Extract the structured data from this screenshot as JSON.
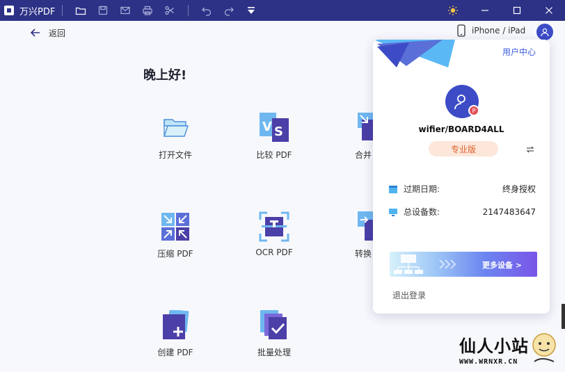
{
  "app": {
    "name": "万兴PDF",
    "titlebar_icons": [
      "folder-icon",
      "save-icon",
      "mail-icon",
      "print-icon",
      "scissors-icon",
      "undo-icon",
      "redo-icon",
      "dropdown-icon"
    ],
    "theme_icon": "sun-icon",
    "window_controls": [
      "minimize-icon",
      "maximize-icon",
      "close-icon"
    ]
  },
  "nav": {
    "back_label": "返回"
  },
  "greeting": "晚上好!",
  "tools": [
    {
      "label": "打开文件",
      "icon": "folder-open-icon"
    },
    {
      "label": "比较 PDF",
      "icon": "compare-icon"
    },
    {
      "label": "合并",
      "icon": "merge-icon"
    },
    {
      "label": "压缩 PDF",
      "icon": "compress-icon"
    },
    {
      "label": "OCR PDF",
      "icon": "ocr-icon"
    },
    {
      "label": "转换",
      "icon": "convert-icon"
    },
    {
      "label": "创建 PDF",
      "icon": "create-icon"
    },
    {
      "label": "批量处理",
      "icon": "batch-icon"
    }
  ],
  "device": {
    "label": "iPhone / iPad"
  },
  "panel": {
    "user_center": "用户中心",
    "username": "wifier/BOARD4ALL",
    "badge_letter": "P",
    "plan": "专业版",
    "expiry_label": "过期日期:",
    "expiry_value": "终身授权",
    "devices_label": "总设备数:",
    "devices_value": "2147483647",
    "more_devices": "更多设备 >",
    "logout": "退出登录"
  },
  "watermark": {
    "title": "仙人小站",
    "url": "WWW.WRNXR.CN"
  },
  "colors": {
    "titlebar": "#2d3286",
    "accent": "#3d4cc6",
    "plan_bg": "#fde6da",
    "plan_text": "#e0622c"
  }
}
